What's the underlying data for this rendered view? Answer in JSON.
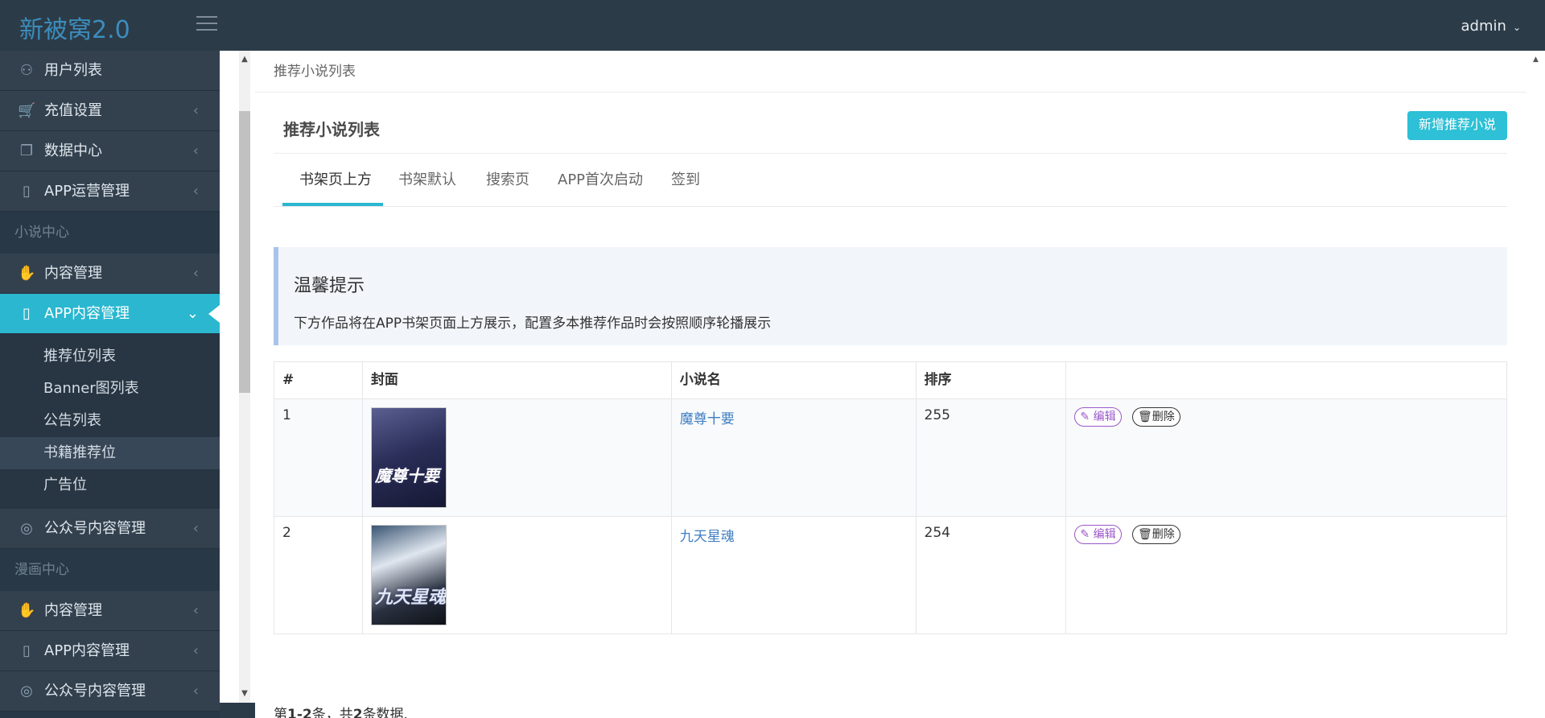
{
  "app": {
    "logo": "新被窝2.0",
    "user": "admin"
  },
  "sidebar": {
    "items_top": [
      {
        "label": "用户列表",
        "icon": "user-icon",
        "glyph": "⚇",
        "has_chevron": false
      },
      {
        "label": "充值设置",
        "icon": "cart-icon",
        "glyph": "🛒",
        "has_chevron": true
      },
      {
        "label": "数据中心",
        "icon": "copy-icon",
        "glyph": "❐",
        "has_chevron": true
      },
      {
        "label": "APP运营管理",
        "icon": "mobile-icon",
        "glyph": "▯",
        "has_chevron": true
      }
    ],
    "section_novel": "小说中心",
    "novel_content": {
      "label": "内容管理",
      "glyph": "✋"
    },
    "novel_app": {
      "label": "APP内容管理",
      "glyph": "▯"
    },
    "submenu": [
      "推荐位列表",
      "Banner图列表",
      "公告列表",
      "书籍推荐位",
      "广告位"
    ],
    "selected_sub_index": 3,
    "wechat_novel": {
      "label": "公众号内容管理",
      "glyph": "◎"
    },
    "section_comic": "漫画中心",
    "comic_content": {
      "label": "内容管理",
      "glyph": "✋"
    },
    "comic_app": {
      "label": "APP内容管理",
      "glyph": "▯"
    },
    "comic_wechat": {
      "label": "公众号内容管理",
      "glyph": "◎"
    },
    "chevron": "‹",
    "chevron_open": "⌄"
  },
  "breadcrumb": "推荐小说列表",
  "panel": {
    "title": "推荐小说列表",
    "add_button": "新增推荐小说",
    "tabs": [
      "书架页上方",
      "书架默认",
      "搜索页",
      "APP首次启动",
      "签到"
    ]
  },
  "tip": {
    "title": "温馨提示",
    "text": "下方作品将在APP书架页面上方展示，配置多本推荐作品时会按照顺序轮播展示"
  },
  "table": {
    "headers": [
      "#",
      "封面",
      "小说名",
      "排序",
      ""
    ],
    "rows": [
      {
        "index": "1",
        "name": "魔尊十要",
        "cover_title": "魔尊十要",
        "cover_author": "",
        "sort": "255"
      },
      {
        "index": "2",
        "name": "九天星魂",
        "cover_title": "九天星魂",
        "cover_author": "",
        "sort": "254"
      }
    ],
    "edit_label": "编辑",
    "delete_label": "删除"
  },
  "summary": {
    "prefix": "第",
    "range": "1-2",
    "mid": "条，共",
    "total": "2",
    "suffix": "条数据."
  }
}
